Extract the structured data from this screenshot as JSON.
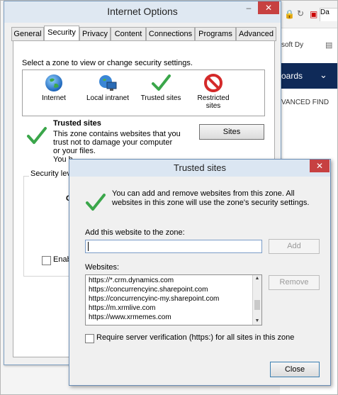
{
  "browser": {
    "tab_label": "Da",
    "url_text": "soft Dy",
    "nav_text": "oards",
    "nav_chevron": "⌄",
    "advanced_find": "VANCED FIND"
  },
  "internet_options": {
    "title": "Internet Options",
    "minimize": "–",
    "close": "✕",
    "tabs": [
      "General",
      "Security",
      "Privacy",
      "Content",
      "Connections",
      "Programs",
      "Advanced"
    ],
    "active_tab": "Security",
    "zone_prompt": "Select a zone to view or change security settings.",
    "zones": [
      {
        "label": "Internet",
        "icon": "globe-icon"
      },
      {
        "label": "Local intranet",
        "icon": "intranet-icon"
      },
      {
        "label": "Trusted sites",
        "icon": "checkmark-icon"
      },
      {
        "label": "Restricted sites",
        "icon": "restricted-icon"
      }
    ],
    "selected_zone_title": "Trusted sites",
    "selected_zone_desc": "This zone contains websites that you trust not to damage your computer or your files.",
    "selected_zone_desc_cut": "You h",
    "sites_button": "Sites",
    "security_level_label": "Security level",
    "obscured_text": "Cu",
    "enable_label": "Enable"
  },
  "trusted_sites": {
    "title": "Trusted sites",
    "close": "✕",
    "info": "You can add and remove websites from this zone. All websites in this zone will use the zone's security settings.",
    "add_label": "Add this website to the zone:",
    "add_value": "",
    "add_button": "Add",
    "websites_label": "Websites:",
    "websites": [
      "https://*.crm.dynamics.com",
      "https://concurrencyinc.sharepoint.com",
      "https://concurrencyinc-my.sharepoint.com",
      "https://m.xrmlive.com",
      "https://www.xrmemes.com"
    ],
    "remove_button": "Remove",
    "require_https_label": "Require server verification (https:) for all sites in this zone",
    "require_https_checked": false,
    "close_button": "Close"
  }
}
